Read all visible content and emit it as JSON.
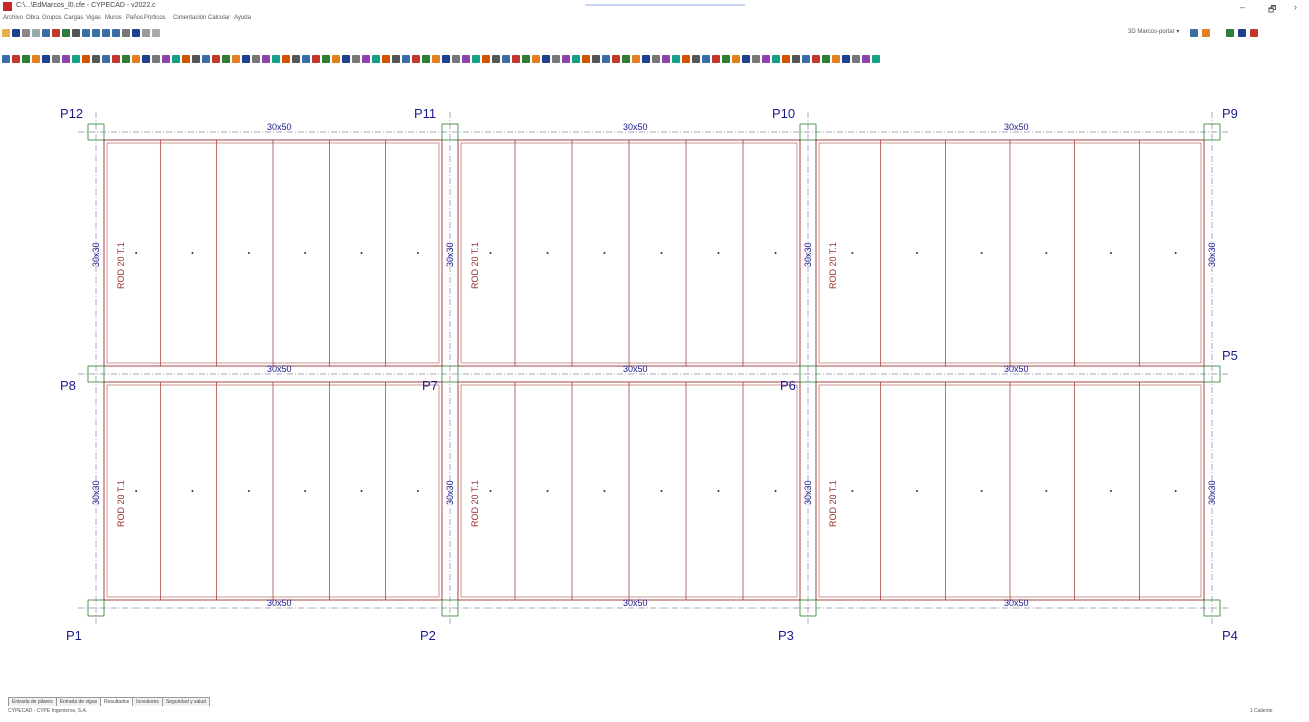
{
  "window": {
    "title": "C:\\...\\EdMarcos_l0.cfe - CYPECAD - v2022.c",
    "controls": {
      "minimize": "–",
      "maximize": "🗗",
      "more": "›"
    }
  },
  "menu": [
    "Archivo",
    "Obra",
    "Grupos",
    "Cargas",
    "Vigas",
    "Muros",
    "Paños",
    "Pórticos",
    "Cimentación",
    "Calcular",
    "Ayuda"
  ],
  "toolbar": {
    "view_select": "3D Marcos-portar ▾"
  },
  "drawing": {
    "columns": [
      {
        "label": "P12"
      },
      {
        "label": "P11"
      },
      {
        "label": "P10"
      },
      {
        "label": "P9"
      },
      {
        "label": "P8"
      },
      {
        "label": "P7"
      },
      {
        "label": "P6"
      },
      {
        "label": "P5"
      },
      {
        "label": "P1"
      },
      {
        "label": "P2"
      },
      {
        "label": "P3"
      },
      {
        "label": "P4"
      }
    ],
    "beam_label": "30x50",
    "column_section_label": "30x30",
    "slab_label": "ROD 20 T.1"
  },
  "tabs": [
    "Entrada de pilares",
    "Entrada de vigas",
    "Resultados",
    "Isovalores",
    "Seguridad y salud"
  ],
  "status": {
    "left": "CYPECAD - CYPE Ingenieros, S.A.",
    "right": "1 Caliente"
  },
  "colors": {
    "beam": "#9b2f2f",
    "column_label": "#1a1a8c",
    "column": "#2e7d32",
    "axis": "#8a8aa8"
  }
}
